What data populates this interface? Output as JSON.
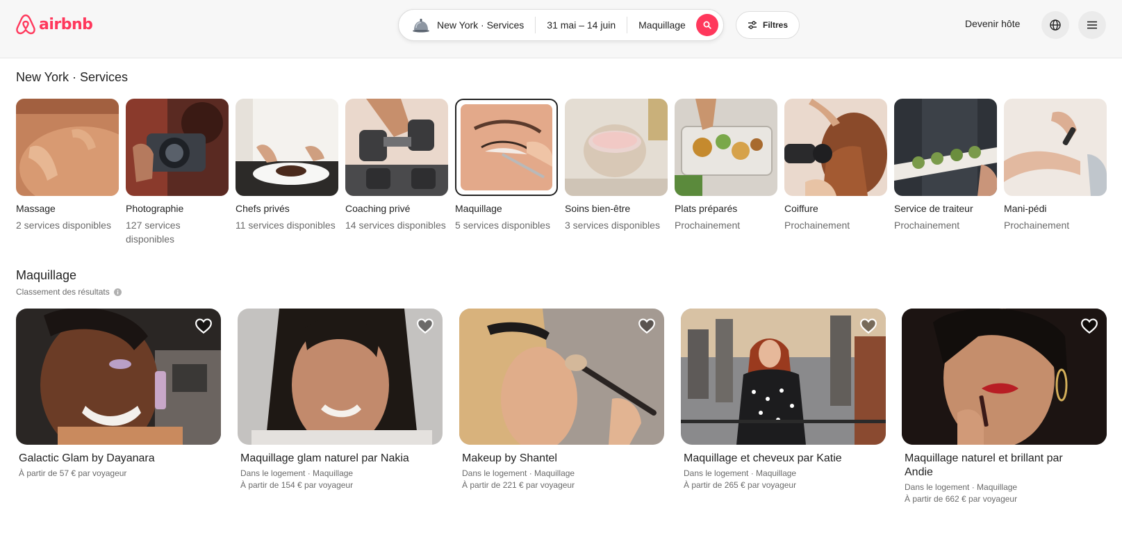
{
  "brand": {
    "name": "airbnb",
    "color": "#ff385c"
  },
  "search": {
    "location": "New York · Services",
    "dates": "31 mai – 14 juin",
    "category": "Maquillage",
    "location_icon": "bell-icon",
    "search_icon": "search-icon"
  },
  "header": {
    "filters_label": "Filtres",
    "host_label": "Devenir hôte",
    "globe_icon": "globe-icon",
    "menu_icon": "menu-icon"
  },
  "categories_section": {
    "title": "New York · Services",
    "items": [
      {
        "name": "Massage",
        "count": "2 services disponibles"
      },
      {
        "name": "Photographie",
        "count": "127 services disponibles"
      },
      {
        "name": "Chefs privés",
        "count": "11 services disponibles"
      },
      {
        "name": "Coaching privé",
        "count": "14 services disponibles"
      },
      {
        "name": "Maquillage",
        "count": "5 services disponibles",
        "selected": true
      },
      {
        "name": "Soins bien-être",
        "count": "3 services disponibles"
      },
      {
        "name": "Plats préparés",
        "count": "Prochainement"
      },
      {
        "name": "Coiffure",
        "count": "Prochainement"
      },
      {
        "name": "Service de traiteur",
        "count": "Prochainement"
      },
      {
        "name": "Mani-pédi",
        "count": "Prochainement"
      }
    ]
  },
  "results": {
    "title": "Maquillage",
    "subtitle": "Classement des résultats",
    "listings": [
      {
        "title": "Galactic Glam by Dayanara",
        "location": "",
        "price": "À partir de 57 € par voyageur"
      },
      {
        "title": "Maquillage glam naturel par Nakia",
        "location": "Dans le logement · Maquillage",
        "price": "À partir de 154 € par voyageur"
      },
      {
        "title": "Makeup by Shantel",
        "location": "Dans le logement · Maquillage",
        "price": "À partir de 221 € par voyageur"
      },
      {
        "title": "Maquillage et cheveux par Katie",
        "location": "Dans le logement · Maquillage",
        "price": "À partir de 265 € par voyageur"
      },
      {
        "title": "Maquillage naturel et brillant par Andie",
        "location": "Dans le logement · Maquillage",
        "price": "À partir de 662 € par voyageur"
      }
    ]
  }
}
